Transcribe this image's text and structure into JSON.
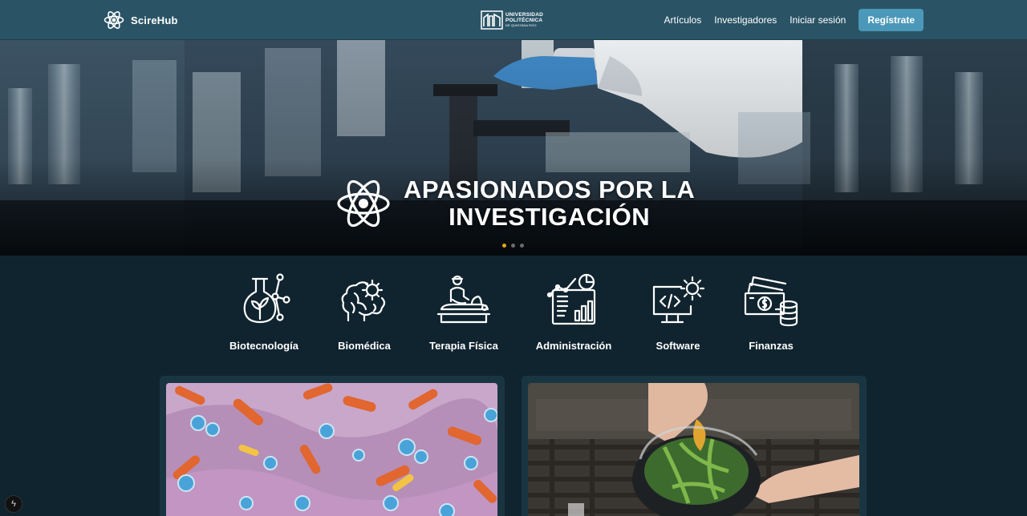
{
  "navbar": {
    "brand": "ScireHub",
    "university_logo": {
      "line1": "UNIVERSIDAD",
      "line2": "POLITÉCNICA",
      "line3": "DE QUINTANA ROO"
    },
    "links": [
      {
        "label": "Artículos"
      },
      {
        "label": "Investigadores"
      },
      {
        "label": "Iniciar sesión"
      }
    ],
    "register_label": "Regístrate"
  },
  "hero": {
    "title_line1": "APASIONADOS POR LA",
    "title_line2": "INVESTIGACIÓN",
    "slides": 3,
    "active_slide": 1,
    "icon": "atom-icon"
  },
  "categories": [
    {
      "label": "Biotecnología",
      "icon": "flask-plant-icon"
    },
    {
      "label": "Biomédica",
      "icon": "brain-gear-icon"
    },
    {
      "label": "Terapia Física",
      "icon": "therapy-icon"
    },
    {
      "label": "Administración",
      "icon": "report-chart-icon"
    },
    {
      "label": "Software",
      "icon": "monitor-code-gear-icon"
    },
    {
      "label": "Finanzas",
      "icon": "money-coins-icon"
    }
  ],
  "colors": {
    "navbar": "#2a5466",
    "page_bg": "#10242f",
    "card_bg": "#1a3542",
    "register_button": "#4b98b8",
    "active_dot": "#e6a817"
  }
}
